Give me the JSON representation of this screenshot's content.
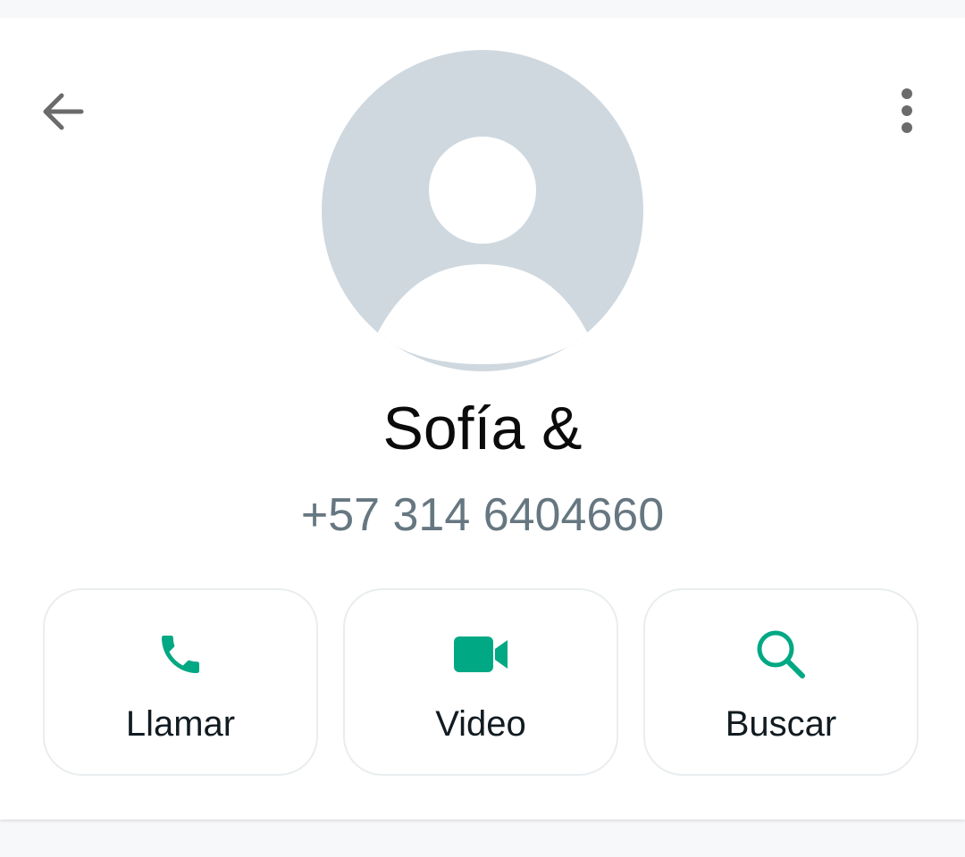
{
  "contact": {
    "name": "Sofía &",
    "phone": "+57 314 6404660"
  },
  "header": {
    "back_icon": "arrow-left-icon",
    "menu_icon": "more-vertical-icon"
  },
  "actions": [
    {
      "label": "Llamar",
      "icon": "phone-icon"
    },
    {
      "label": "Video",
      "icon": "video-camera-icon"
    },
    {
      "label": "Buscar",
      "icon": "search-icon"
    }
  ],
  "colors": {
    "accent": "#00a884",
    "avatar_bg": "#cfd8df",
    "muted_text": "#667781",
    "icon_gray": "#6b6b6b"
  }
}
